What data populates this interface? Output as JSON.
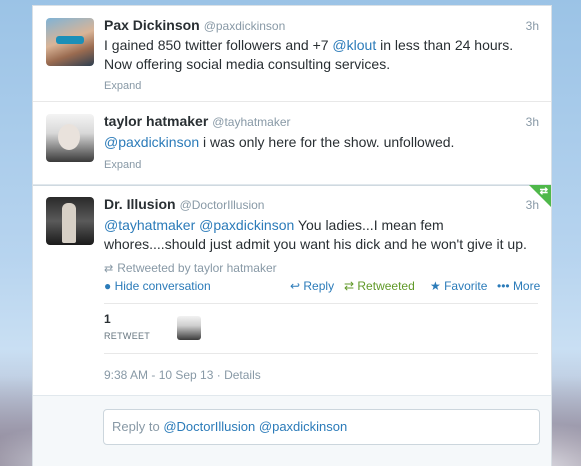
{
  "tweets": [
    {
      "name": "Pax Dickinson",
      "handle": "@paxdickinson",
      "time": "3h",
      "text_prefix": "I gained 850 twitter followers and +7 ",
      "text_link": "@klout",
      "text_suffix": " in less than 24 hours. Now offering social media consulting services.",
      "expand": "Expand"
    },
    {
      "name": "taylor hatmaker",
      "handle": "@tayhatmaker",
      "time": "3h",
      "text_link": "@paxdickinson",
      "text_suffix": " i was only here for the show. unfollowed.",
      "expand": "Expand"
    },
    {
      "name": "Dr. Illusion",
      "handle": "@DoctorIllusion",
      "time": "3h",
      "text_link1": "@tayhatmaker",
      "text_link2": "@paxdickinson",
      "text_suffix": " You ladies...I mean fem whores....should just admit you want his dick and he won't give it up.",
      "retweeted_by": "Retweeted by taylor hatmaker",
      "actions": {
        "hide_conversation": "Hide conversation",
        "reply": "Reply",
        "retweeted": "Retweeted",
        "favorite": "Favorite",
        "more": "More"
      },
      "retweet_count": "1",
      "retweet_label": "RETWEET",
      "timestamp": "9:38 AM - 10 Sep 13 · Details"
    }
  ],
  "reply": {
    "prefix": "Reply to ",
    "mention1": "@DoctorIllusion",
    "mention2": "@paxdickinson"
  },
  "colors": {
    "link": "#2b7bb9",
    "retweeted": "#609928",
    "corner_badge": "#4fb84a"
  }
}
